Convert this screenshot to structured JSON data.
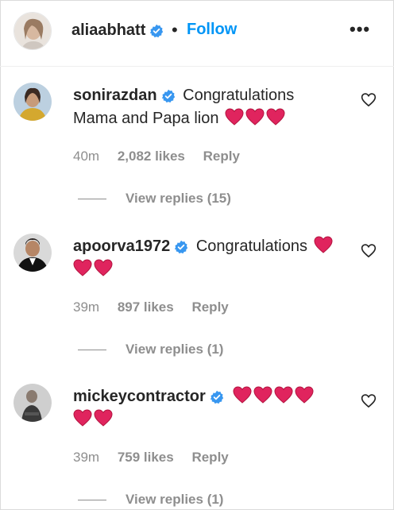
{
  "post_header": {
    "username": "aliaabhatt",
    "separator": "•",
    "follow_label": "Follow",
    "more_label": "•••"
  },
  "comments": [
    {
      "username": "sonirazdan",
      "text_lines": [
        "Congratulations",
        "Mama and Papa lion"
      ],
      "hearts": 3,
      "time": "40m",
      "likes": "2,082 likes",
      "reply_label": "Reply",
      "view_replies": "View replies (15)"
    },
    {
      "username": "apoorva1972",
      "text": "Congratulations",
      "hearts_inline": 1,
      "hearts_next_line": 2,
      "time": "39m",
      "likes": "897 likes",
      "reply_label": "Reply",
      "view_replies": "View replies (1)"
    },
    {
      "username": "mickeycontractor",
      "hearts_inline": 4,
      "hearts_next_line": 2,
      "time": "39m",
      "likes": "759 likes",
      "reply_label": "Reply",
      "view_replies": "View replies (1)"
    }
  ],
  "colors": {
    "text": "#262626",
    "secondary": "#8e8e8e",
    "link_blue": "#0095f6",
    "verified_blue": "#3897f0",
    "heart_red": "#e0245e"
  },
  "icons": {
    "verified": "verified-badge-icon",
    "like": "heart-outline-icon",
    "emoji_heart": "red-heart-emoji"
  }
}
